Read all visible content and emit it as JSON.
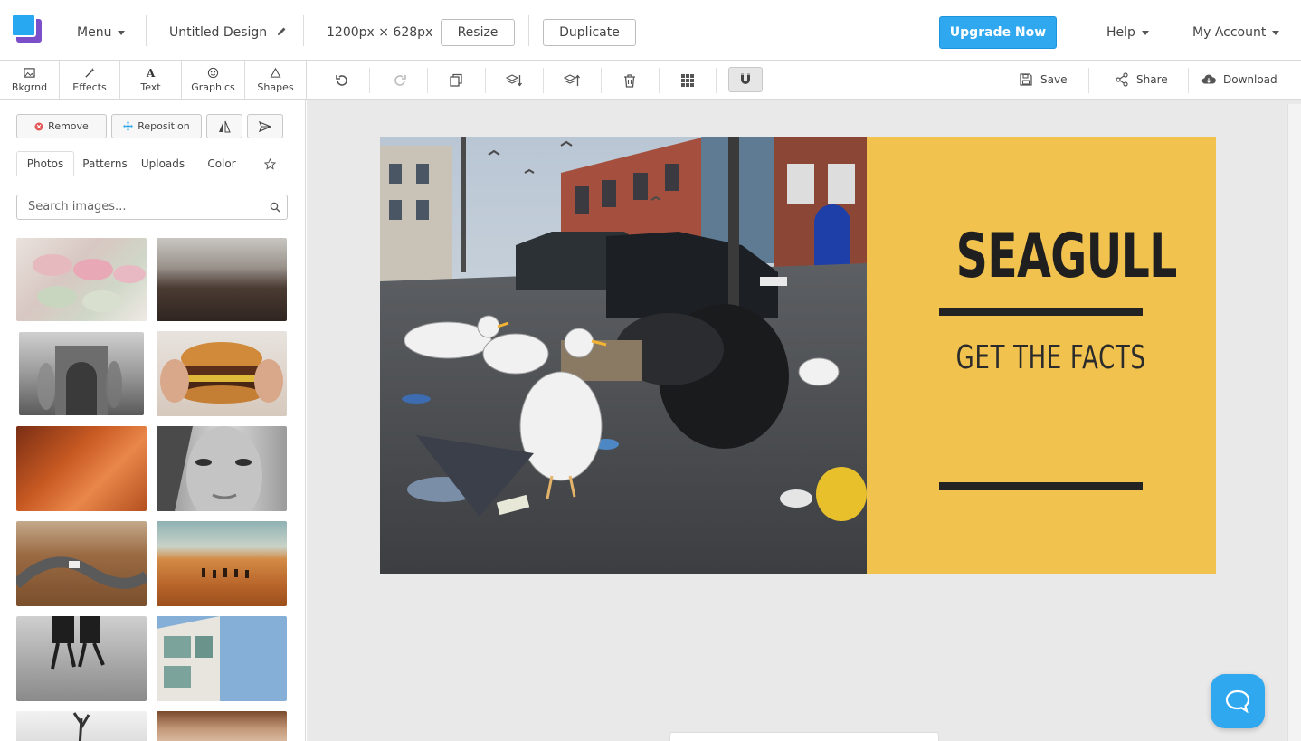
{
  "header": {
    "menu_label": "Menu",
    "design_name": "Untitled Design",
    "dimensions": "1200px × 628px",
    "resize_label": "Resize",
    "duplicate_label": "Duplicate",
    "upgrade_label": "Upgrade Now",
    "help_label": "Help",
    "account_label": "My Account"
  },
  "tool_tabs": [
    {
      "label": "Bkgrnd",
      "icon": "image-icon"
    },
    {
      "label": "Effects",
      "icon": "wand-icon"
    },
    {
      "label": "Text",
      "icon": "text-icon"
    },
    {
      "label": "Graphics",
      "icon": "smiley-icon"
    },
    {
      "label": "Shapes",
      "icon": "triangle-icon"
    }
  ],
  "canvas_toolbar": {
    "save_label": "Save",
    "share_label": "Share",
    "download_label": "Download"
  },
  "panel": {
    "remove_label": "Remove",
    "reposition_label": "Reposition",
    "subtabs": [
      "Photos",
      "Patterns",
      "Uploads",
      "Color"
    ],
    "active_subtab": "Photos",
    "search_placeholder": "Search images..."
  },
  "design": {
    "headline": "SEAGULL",
    "subline": "GET THE FACTS",
    "panel_color": "#f2c24f"
  },
  "colors": {
    "accent": "#2fa8f0",
    "logo_purple": "#7b4fc9"
  }
}
